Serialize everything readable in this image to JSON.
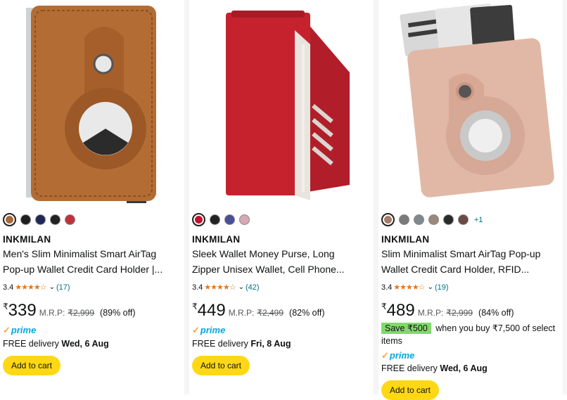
{
  "products": [
    {
      "brand": "INKMILAN",
      "title_lines": [
        "Men's Slim Minimalist Smart AirTag",
        "Pop-up Wallet Credit Card Holder |..."
      ],
      "rating": "3.4",
      "stars": "★★★★☆",
      "reviews": "(17)",
      "currency": "₹",
      "price": "339",
      "mrp_label": "M.R.P:",
      "mrp": "₹2,999",
      "discount": "(89% off)",
      "prime": "prime",
      "delivery_label": "FREE delivery",
      "delivery_date": "Wed, 6 Aug",
      "cart_label": "Add to cart",
      "swatch_colors": [
        "#a86a3c",
        "#1f1f1f",
        "#1e2a55",
        "#222222",
        "#c0323a"
      ],
      "image_icon": "brown-airtag-wallet"
    },
    {
      "brand": "INKMILAN",
      "title_lines": [
        "Sleek Wallet Money Purse, Long",
        "Zipper Unisex Wallet, Cell Phone..."
      ],
      "rating": "3.4",
      "stars": "★★★★☆",
      "reviews": "(42)",
      "currency": "₹",
      "price": "449",
      "mrp_label": "M.R.P:",
      "mrp": "₹2,499",
      "discount": "(82% off)",
      "prime": "prime",
      "delivery_label": "FREE delivery",
      "delivery_date": "Fri, 8 Aug",
      "cart_label": "Add to cart",
      "swatch_colors": [
        "#c0142c",
        "#222222",
        "#4a4f9a",
        "#d7a8b6"
      ],
      "image_icon": "red-long-wallet"
    },
    {
      "brand": "INKMILAN",
      "title_lines": [
        "Slim Minimalist Smart AirTag Pop-up",
        "Wallet Credit Card Holder, RFID..."
      ],
      "rating": "3.4",
      "stars": "★★★★☆",
      "reviews": "(19)",
      "currency": "₹",
      "price": "489",
      "mrp_label": "M.R.P:",
      "mrp": "₹2,999",
      "discount": "(84% off)",
      "save_badge": "Save ₹500",
      "save_text": "when you buy ₹7,500 of select items",
      "prime": "prime",
      "delivery_label": "FREE delivery",
      "delivery_date": "Wed, 6 Aug",
      "cart_label": "Add to cart",
      "swatch_colors": [
        "#a77d6c",
        "#7a7a7a",
        "#808890",
        "#9a8878",
        "#2a2a2a",
        "#6a4a42"
      ],
      "more_colors": "+1",
      "image_icon": "pink-airtag-wallet"
    }
  ],
  "colors": {
    "cart_button": "#ffd814",
    "link": "#007185",
    "star": "#de7921",
    "prime": "#00a8e1",
    "save_badge": "#7fda69"
  }
}
